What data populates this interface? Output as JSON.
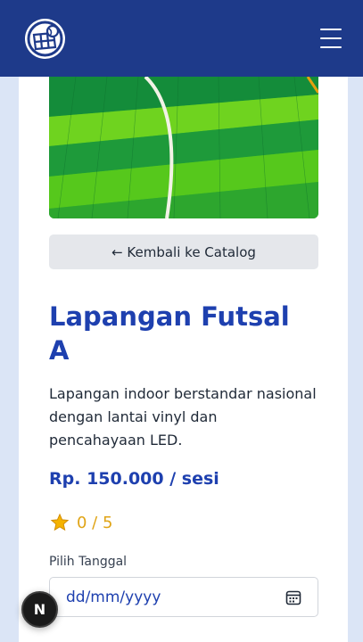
{
  "navbar": {
    "logo_icon": "tennis-court-ball-icon",
    "menu_icon": "hamburger-menu-icon"
  },
  "hero": {
    "image": "green-futsal-court-floor"
  },
  "back_button": {
    "label": "← Kembali ke Catalog"
  },
  "venue": {
    "title": "Lapangan Futsal A",
    "description": "Lapangan indoor berstandar nasional dengan lantai vinyl dan pencahayaan LED.",
    "price": "Rp. 150.000 / sesi"
  },
  "rating": {
    "icon": "star-icon",
    "text": "0 / 5",
    "color": "#e0a416"
  },
  "date": {
    "label": "Pilih Tanggal",
    "placeholder": "dd/mm/yyyy",
    "icon": "calendar-icon"
  },
  "floating_badge": {
    "label": "N"
  },
  "colors": {
    "navbar": "#1e3a8a",
    "accent": "#1e40af",
    "star": "#f5b301"
  }
}
